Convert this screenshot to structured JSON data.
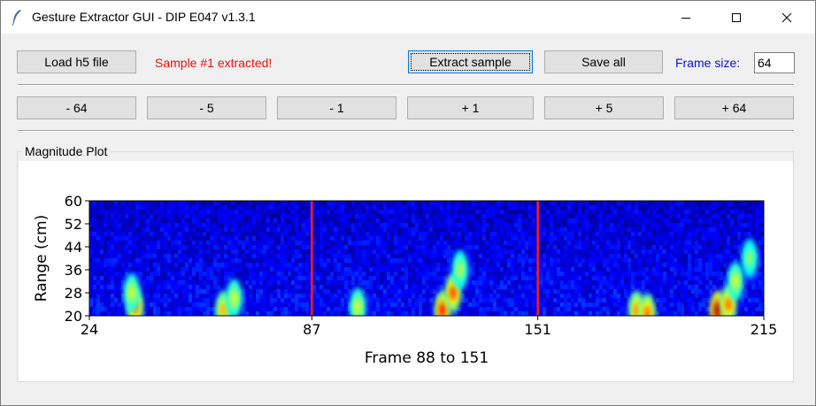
{
  "window": {
    "title": "Gesture Extractor GUI - DIP E047 v1.3.1"
  },
  "toolbar": {
    "load_label": "Load h5 file",
    "status_text": "Sample #1 extracted!",
    "extract_label": "Extract sample",
    "save_label": "Save all",
    "frame_size_label": "Frame size:",
    "frame_size_value": "64"
  },
  "nav": {
    "minus64": "- 64",
    "minus5": "- 5",
    "minus1": "- 1",
    "plus1": "+ 1",
    "plus5": "+ 5",
    "plus64": "+ 64"
  },
  "group": {
    "label": "Magnitude Plot"
  },
  "chart_data": {
    "type": "heatmap",
    "title": "",
    "xlabel": "Frame 88 to 151",
    "ylabel": "Range (cm)",
    "xlim": [
      24,
      215
    ],
    "ylim": [
      20,
      60
    ],
    "x_ticks": [
      "24",
      "87",
      "151",
      "215"
    ],
    "y_ticks": [
      "20",
      "28",
      "36",
      "44",
      "52",
      "60"
    ],
    "markers": [
      87,
      151
    ],
    "marker_color": "#ff1a1a",
    "colormap": "jet",
    "hotspots": [
      {
        "frame": 37,
        "range": 23,
        "intensity": 0.7
      },
      {
        "frame": 36,
        "range": 28,
        "intensity": 0.45
      },
      {
        "frame": 62,
        "range": 22,
        "intensity": 0.6
      },
      {
        "frame": 65,
        "range": 26,
        "intensity": 0.45
      },
      {
        "frame": 100,
        "range": 23,
        "intensity": 0.45
      },
      {
        "frame": 124,
        "range": 22,
        "intensity": 0.8
      },
      {
        "frame": 127,
        "range": 28,
        "intensity": 0.75
      },
      {
        "frame": 129,
        "range": 36,
        "intensity": 0.4
      },
      {
        "frame": 179,
        "range": 22,
        "intensity": 0.65
      },
      {
        "frame": 182,
        "range": 21,
        "intensity": 0.7
      },
      {
        "frame": 202,
        "range": 22,
        "intensity": 0.95
      },
      {
        "frame": 205,
        "range": 24,
        "intensity": 0.7
      },
      {
        "frame": 207,
        "range": 32,
        "intensity": 0.45
      },
      {
        "frame": 211,
        "range": 40,
        "intensity": 0.35
      }
    ]
  }
}
